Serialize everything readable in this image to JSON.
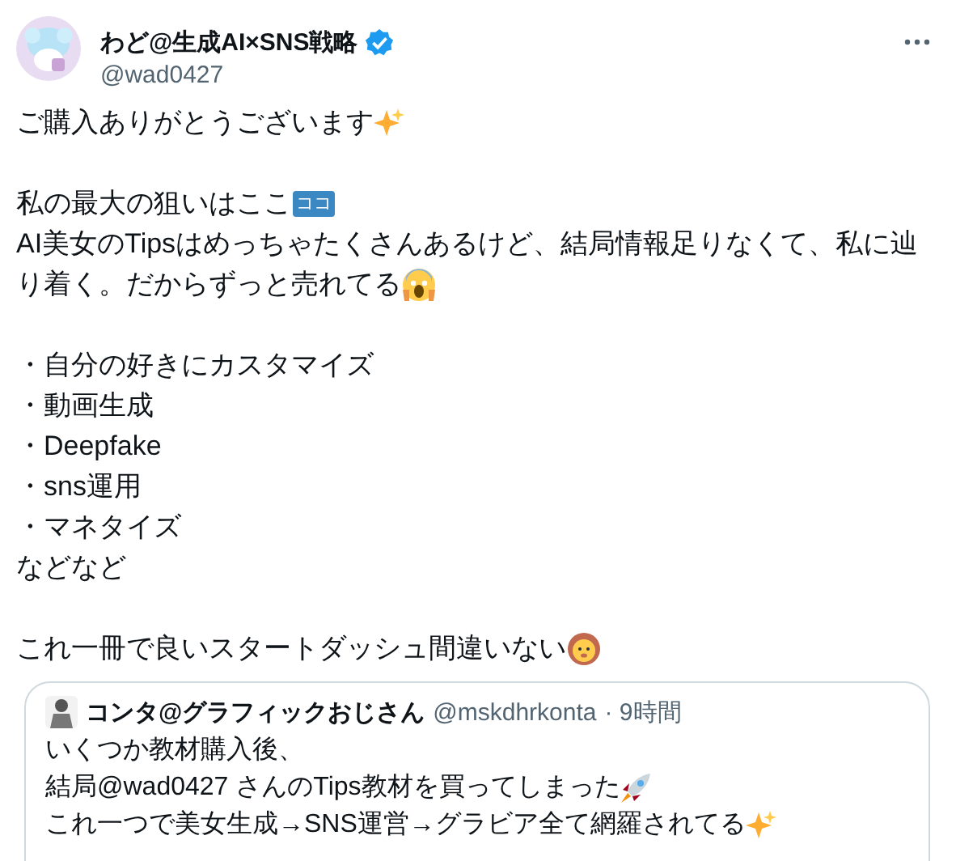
{
  "author": {
    "name": "わど@生成AI×SNS戦略",
    "verified": true,
    "handle": "@wad0427"
  },
  "body": [
    {
      "kind": "text",
      "text": "ご購入ありがとうございます",
      "emoji": {
        "kind": "sparkles"
      }
    },
    {
      "kind": "blank"
    },
    {
      "kind": "text",
      "text": "私の最大の狙いはここ",
      "badge": "ココ"
    },
    {
      "kind": "text",
      "text": "AI美女のTipsはめっちゃたくさんあるけど、結局情報足りなくて、私に辿"
    },
    {
      "kind": "text",
      "text": "り着く。だからずっと売れてる",
      "emoji": {
        "kind": "scream"
      }
    },
    {
      "kind": "blank"
    },
    {
      "kind": "text",
      "text": "・自分の好きにカスタマイズ"
    },
    {
      "kind": "text",
      "text": "・動画生成"
    },
    {
      "kind": "text",
      "text": "・Deepfake"
    },
    {
      "kind": "text",
      "text": "・sns運用"
    },
    {
      "kind": "text",
      "text": "・マネタイズ"
    },
    {
      "kind": "text",
      "text": "などなど"
    },
    {
      "kind": "blank"
    },
    {
      "kind": "text",
      "text": "これ一冊で良いスタートダッシュ間違いない",
      "emoji": {
        "kind": "lion"
      }
    }
  ],
  "quote": {
    "name": "コンタ@グラフィックおじさん",
    "handle": "@mskdhrkonta",
    "time": "· 9時間",
    "lines": [
      {
        "text": "いくつか教材購入後、"
      },
      {
        "text": "結局@wad0427 さんのTips教材を買ってしまった",
        "emoji": {
          "kind": "rocket"
        }
      },
      {
        "text": "これ一つで美女生成→SNS運営→グラビア全て網羅されてる",
        "emoji": {
          "kind": "sparkles"
        }
      }
    ]
  }
}
